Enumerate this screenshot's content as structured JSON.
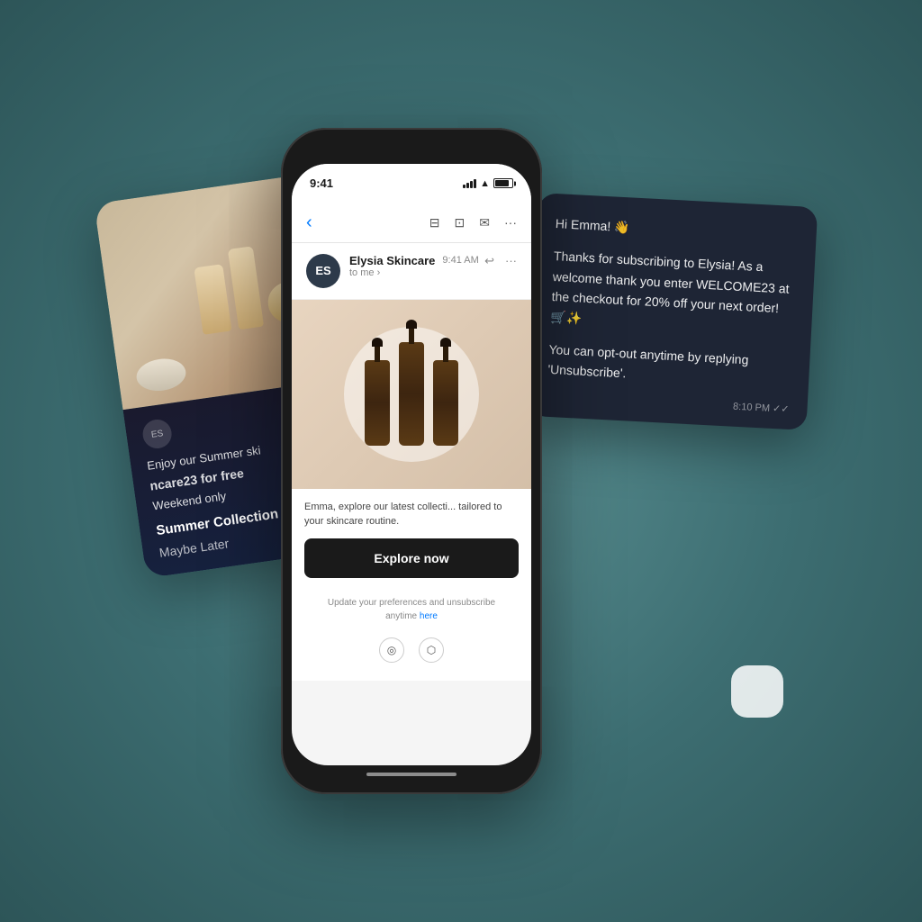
{
  "scene": {
    "background_color": "#4a7a7c"
  },
  "skincare_card": {
    "logo_text": "ES",
    "line1": "Enjoy our Summer ski",
    "line2": "ncare23 for free",
    "line3": "Weekend only",
    "collection_label": "Summer Collection",
    "cta": "Maybe Later"
  },
  "phone": {
    "status_bar": {
      "time": "9:41",
      "signal": "●●●●",
      "wifi": "WiFi",
      "battery": "100%"
    },
    "toolbar": {
      "back": "‹",
      "icons": [
        "⊟",
        "⊡",
        "✉",
        "···"
      ]
    },
    "email": {
      "sender": {
        "avatar": "ES",
        "name": "Elysia Skincare",
        "time": "9:41 AM",
        "to": "to me ›"
      },
      "actions": [
        "↩",
        "···"
      ],
      "body_text": "Emma, explore our latest collecti... tailored to your skincare routine.",
      "explore_button": "Explore now",
      "footer_text": "Update your preferences and unsubscribe anytime ",
      "footer_link": "here"
    }
  },
  "sms_card": {
    "greeting": "Hi Emma! 👋",
    "paragraph1": "Thanks for subscribing to Elysia! As a welcome thank you enter WELCOME23 at the checkout for 20% off your next order! 🛒✨",
    "paragraph2": "You can opt-out anytime by replying 'Unsubscribe'.",
    "time": "8:10 PM ✓✓"
  }
}
